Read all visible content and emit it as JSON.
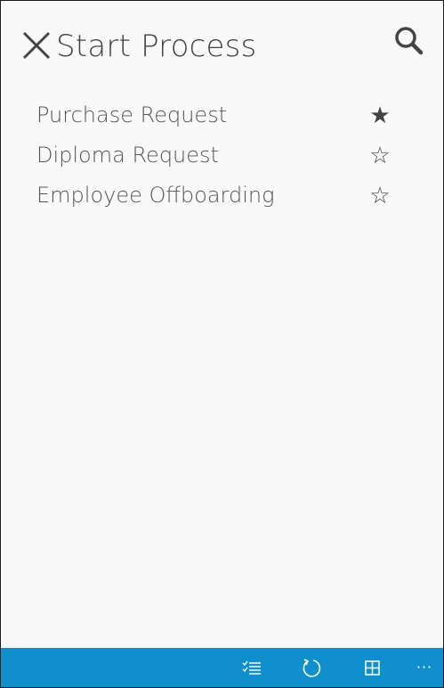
{
  "header": {
    "title": "Start Process",
    "close_icon": "close-icon",
    "search_icon": "search-icon"
  },
  "processes": [
    {
      "label": "Purchase Request",
      "favorite": true,
      "star_glyph": "★"
    },
    {
      "label": "Diploma Request",
      "favorite": false,
      "star_glyph": "☆"
    },
    {
      "label": "Employee Offboarding",
      "favorite": false,
      "star_glyph": "☆"
    }
  ],
  "appbar": {
    "color": "#0f8fcd",
    "buttons": [
      "checklist-icon",
      "refresh-icon",
      "grid-icon"
    ],
    "more_label": "···"
  }
}
